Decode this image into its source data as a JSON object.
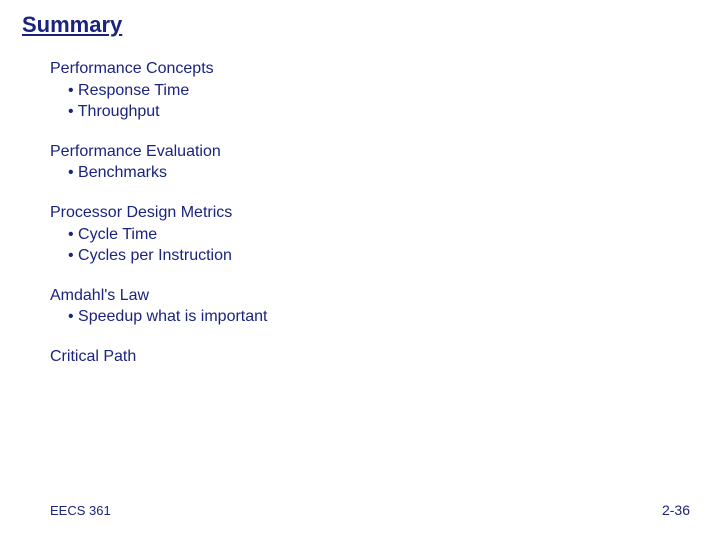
{
  "title": "Summary",
  "sections": [
    {
      "head": "Performance Concepts",
      "bullets": [
        "Response Time",
        "Throughput"
      ]
    },
    {
      "head": "Performance Evaluation",
      "bullets": [
        "Benchmarks"
      ]
    },
    {
      "head": "Processor Design Metrics",
      "bullets": [
        "Cycle Time",
        "Cycles per Instruction"
      ]
    },
    {
      "head": "Amdahl's Law",
      "bullets": [
        "Speedup what is important"
      ]
    },
    {
      "head": "Critical Path",
      "bullets": []
    }
  ],
  "footer": {
    "course": "EECS 361",
    "page": "2-36"
  }
}
